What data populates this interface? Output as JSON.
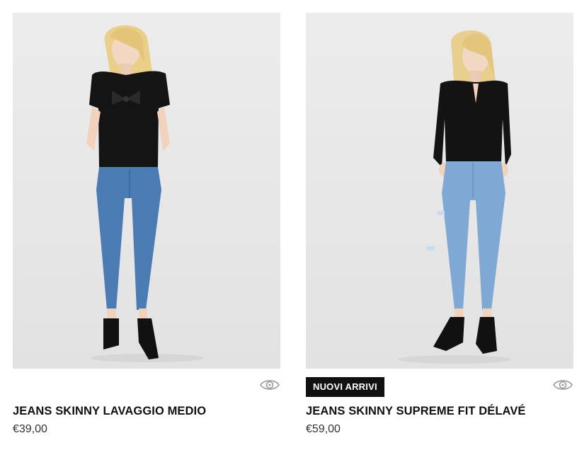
{
  "products": [
    {
      "title": "JEANS SKINNY LAVAGGIO MEDIO",
      "price": "€39,00",
      "badge": "",
      "image_alt": "Model wearing black puff-sleeve top and medium-wash skinny jeans",
      "quick_view_icon": "eye-icon"
    },
    {
      "title": "JEANS SKINNY SUPREME FIT DÉLAVÉ",
      "price": "€59,00",
      "badge": "NUOVI ARRIVI",
      "image_alt": "Model wearing black keyhole blouse and light-wash distressed skinny jeans",
      "quick_view_icon": "eye-icon"
    }
  ],
  "colors": {
    "badge_bg": "#111111",
    "badge_text": "#ffffff",
    "title": "#111111",
    "price": "#333333",
    "photo_bg": "#e8e8e8"
  }
}
